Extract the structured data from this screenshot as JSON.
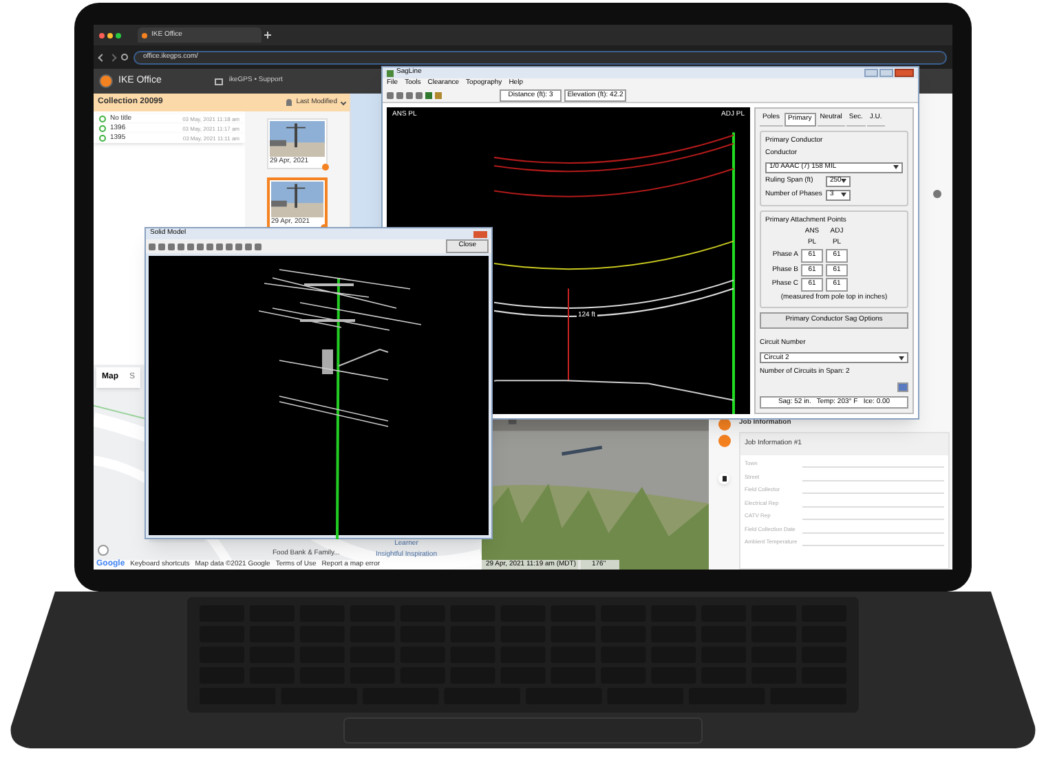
{
  "browser": {
    "tab_title": "IKE Office",
    "url": "office.ikegps.com/"
  },
  "header": {
    "app_name": "IKE Office",
    "support_link": "ikeGPS • Support"
  },
  "collection": {
    "title": "Collection 20099",
    "sort": "Last Modified",
    "items": [
      {
        "name": "No title",
        "date": "03 May, 2021 11:18 am"
      },
      {
        "name": "1396",
        "date": "03 May, 2021 11:17 am"
      },
      {
        "name": "1395",
        "date": "03 May, 2021 11:11 am"
      }
    ],
    "thumbnails": [
      {
        "date": "29 Apr, 2021",
        "selected": false
      },
      {
        "date": "29 Apr, 2021",
        "selected": true
      }
    ]
  },
  "map": {
    "tabs": [
      {
        "label": "Map",
        "selected": true
      },
      {
        "label": "S",
        "selected": false
      }
    ],
    "places": [
      "Food Bank & Family...",
      "Learner",
      "Insightful Inspiration"
    ],
    "attribution": [
      "Keyboard shortcuts",
      "Map data ©2021 Google",
      "Terms of Use",
      "Report a map error"
    ],
    "logo": "Google"
  },
  "photo": {
    "timestamp": "29 Apr, 2021 11:19 am (MDT)",
    "measurement": "176\""
  },
  "sagline": {
    "title": "SagLine",
    "menu": [
      "File",
      "Tools",
      "Clearance",
      "Topography",
      "Help"
    ],
    "distance": "Distance (ft): 3",
    "elevation": "Elevation (ft): 42.2",
    "plot_labels": [
      "ANS PL",
      "ADJ PL"
    ],
    "span_label": "124 ft",
    "tabs": [
      {
        "label": "Poles",
        "selected": false
      },
      {
        "label": "Primary",
        "selected": true
      },
      {
        "label": "Neutral",
        "selected": false
      },
      {
        "label": "Sec.",
        "selected": false
      },
      {
        "label": "J.U.",
        "selected": false
      }
    ],
    "conductor_group": {
      "title": "Primary Conductor",
      "conductor_label": "Conductor",
      "conductor": "1/0 AAAC (7) 158 MIL",
      "span_label": "Ruling Span (ft)",
      "span": "250",
      "phases_label": "Number of Phases",
      "phases": "3"
    },
    "attachment_group": {
      "title": "Primary Attachment Points",
      "columns": [
        "ANS PL",
        "ADJ PL"
      ],
      "rows": [
        {
          "label": "Phase A",
          "values": [
            "61",
            "61"
          ]
        },
        {
          "label": "Phase B",
          "values": [
            "61",
            "61"
          ]
        },
        {
          "label": "Phase C",
          "values": [
            "61",
            "61"
          ]
        }
      ],
      "note": "(measured from pole top in inches)"
    },
    "sag_button": "Primary Conductor Sag Options",
    "circuit_label": "Circuit Number",
    "circuit": "Circuit 2",
    "circuits_note": "Number of Circuits in Span: 2",
    "status": "Sag: 52 in.   Temp: 203° F   Ice: 0.00"
  },
  "solid_model": {
    "title": "Solid Model",
    "close": "Close"
  },
  "job": {
    "section": "Job Information",
    "card_title": "Job Information #1",
    "fields": [
      "Town",
      "Street",
      "Field Collector",
      "Electrical Rep",
      "CATV Rep",
      "Field Collection Date",
      "Ambient Temperature"
    ]
  }
}
